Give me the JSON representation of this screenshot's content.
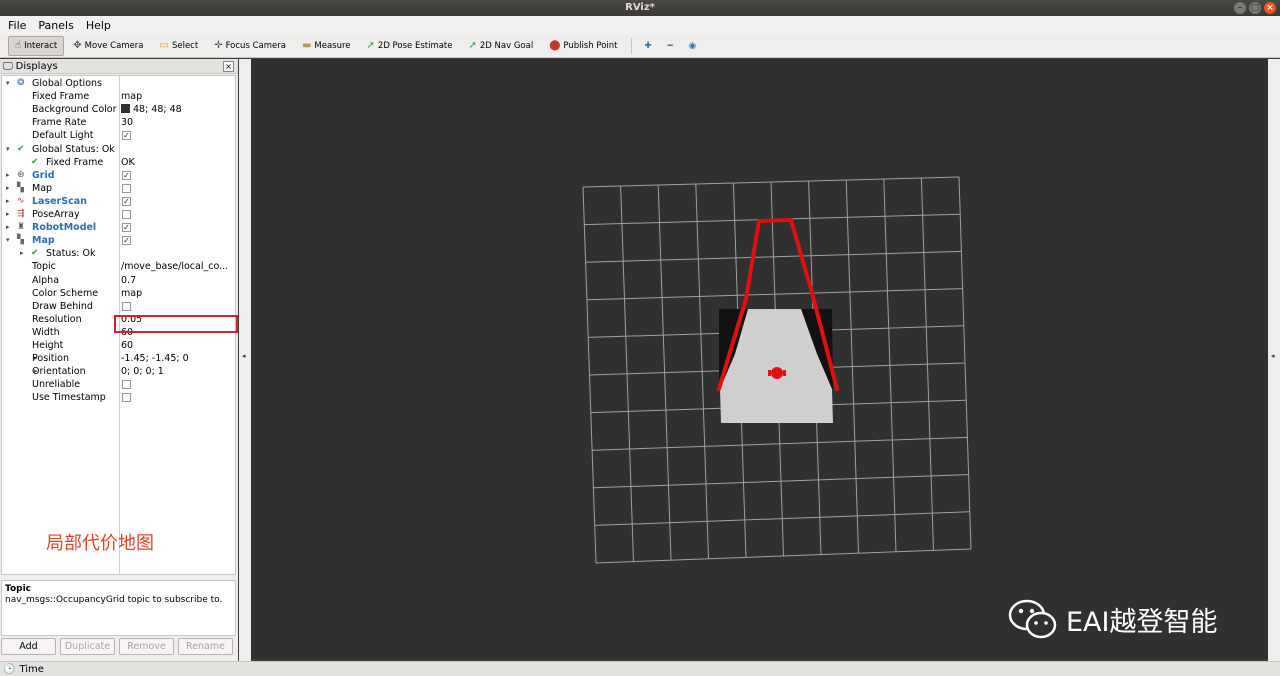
{
  "window": {
    "title": "RViz*",
    "controls": [
      "–",
      "□",
      "×"
    ]
  },
  "menu": [
    {
      "label": "File"
    },
    {
      "label": "Panels"
    },
    {
      "label": "Help"
    }
  ],
  "toolbar": {
    "tools": [
      {
        "label": "Interact",
        "icon": "hand-icon",
        "glyph": "☝",
        "color": "#333333",
        "active": true
      },
      {
        "label": "Move Camera",
        "icon": "move-camera-icon",
        "glyph": "✥",
        "color": "#555555"
      },
      {
        "label": "Select",
        "icon": "select-icon",
        "glyph": "▭",
        "color": "#c9a227"
      },
      {
        "label": "Focus Camera",
        "icon": "focus-camera-icon",
        "glyph": "✛",
        "color": "#555555"
      },
      {
        "label": "Measure",
        "icon": "ruler-icon",
        "glyph": "▬",
        "color": "#b59b5c"
      },
      {
        "label": "2D Pose Estimate",
        "icon": "pose-estimate-arrow-icon",
        "glyph": "➚",
        "color": "#2ea043"
      },
      {
        "label": "2D Nav Goal",
        "icon": "nav-goal-arrow-icon",
        "glyph": "➚",
        "color": "#2ea043"
      },
      {
        "label": "Publish Point",
        "icon": "map-pin-icon",
        "glyph": "⬤",
        "color": "#c0392b"
      }
    ],
    "extra_icons": [
      {
        "name": "add-tool-icon",
        "glyph": "✚",
        "color": "#2a6fb0"
      },
      {
        "name": "remove-tool-icon",
        "glyph": "━",
        "color": "#2a6fb0"
      },
      {
        "name": "view-options-icon",
        "glyph": "◉",
        "color": "#2a6fb0"
      }
    ]
  },
  "displays_panel": {
    "title": "Displays",
    "close": "×",
    "rows": [
      {
        "label": "Global Options",
        "indent": 0,
        "expand": "▾",
        "icon": "globe-icon",
        "glyph": "❂",
        "iconColor": "#3b6db3"
      },
      {
        "label": "Fixed Frame",
        "indent": 2,
        "value": "map"
      },
      {
        "label": "Background Color",
        "indent": 2,
        "value": "48; 48; 48",
        "swatch": "#303030"
      },
      {
        "label": "Frame Rate",
        "indent": 2,
        "value": "30"
      },
      {
        "label": "Default Light",
        "indent": 2,
        "checkbox": true,
        "checked": true
      },
      {
        "label": "Global Status: Ok",
        "indent": 0,
        "expand": "▾",
        "icon": "check-icon",
        "glyph": "✔",
        "iconColor": "#2ea043"
      },
      {
        "label": "Fixed Frame",
        "indent": 1,
        "value": "OK",
        "icon": "check-icon",
        "glyph": "✔",
        "iconColor": "#2ea043"
      },
      {
        "label": "Grid",
        "indent": 0,
        "expand": "▸",
        "icon": "grid-icon",
        "glyph": "⊛",
        "iconColor": "#555555",
        "bold": true,
        "checkbox": true,
        "checked": true
      },
      {
        "label": "Map",
        "indent": 0,
        "expand": "▸",
        "icon": "map-icon",
        "glyph": "▚",
        "iconColor": "#666666",
        "checkbox": true,
        "checked": false
      },
      {
        "label": "LaserScan",
        "indent": 0,
        "expand": "▸",
        "icon": "laser-scan-icon",
        "glyph": "∿",
        "iconColor": "#c0392b",
        "bold": true,
        "checkbox": true,
        "checked": true
      },
      {
        "label": "PoseArray",
        "indent": 0,
        "expand": "▸",
        "icon": "pose-array-icon",
        "glyph": "⇶",
        "iconColor": "#c0392b",
        "checkbox": true,
        "checked": false
      },
      {
        "label": "RobotModel",
        "indent": 0,
        "expand": "▸",
        "icon": "robot-model-icon",
        "glyph": "♜",
        "iconColor": "#555555",
        "bold": true,
        "checkbox": true,
        "checked": true
      },
      {
        "label": "Map",
        "indent": 0,
        "expand": "▾",
        "icon": "map-icon",
        "glyph": "▚",
        "iconColor": "#666666",
        "bold": true,
        "checkbox": true,
        "checked": true
      },
      {
        "label": "Status: Ok",
        "indent": 1,
        "expand": "▸",
        "icon": "check-icon",
        "glyph": "✔",
        "iconColor": "#2ea043"
      },
      {
        "label": "Topic",
        "indent": 2,
        "value": "/move_base/local_co..."
      },
      {
        "label": "Alpha",
        "indent": 2,
        "value": "0.7"
      },
      {
        "label": "Color Scheme",
        "indent": 2,
        "value": "map"
      },
      {
        "label": "Draw Behind",
        "indent": 2,
        "checkbox": true,
        "checked": false
      },
      {
        "label": "Resolution",
        "indent": 2,
        "value": "0.05"
      },
      {
        "label": "Width",
        "indent": 2,
        "value": "60"
      },
      {
        "label": "Height",
        "indent": 2,
        "value": "60"
      },
      {
        "label": "Position",
        "indent": 2,
        "expand": "▸",
        "value": "-1.45; -1.45; 0"
      },
      {
        "label": "Orientation",
        "indent": 2,
        "expand": "▸",
        "value": "0; 0; 0; 1"
      },
      {
        "label": "Unreliable",
        "indent": 2,
        "checkbox": true,
        "checked": false
      },
      {
        "label": "Use Timestamp",
        "indent": 2,
        "checkbox": true,
        "checked": false
      }
    ],
    "annotation": "局部代价地图",
    "description": {
      "title": "Topic",
      "text": "nav_msgs::OccupancyGrid topic to subscribe to."
    },
    "buttons": [
      {
        "label": "Add",
        "enabled": true
      },
      {
        "label": "Duplicate",
        "enabled": false
      },
      {
        "label": "Remove",
        "enabled": false
      },
      {
        "label": "Rename",
        "enabled": false
      }
    ]
  },
  "collapse_left": "◂",
  "collapse_right": "◂",
  "time_panel": {
    "label": "Time"
  },
  "watermark": {
    "text": "EAI越登智能"
  },
  "colors": {
    "viewport_bg": "#303030",
    "grid_line": "#a0a0a0",
    "laser": "#e01010",
    "costmap_free": "#cfcfcf",
    "costmap_lethal": "#111111",
    "highlight_box": "#d4242a"
  }
}
